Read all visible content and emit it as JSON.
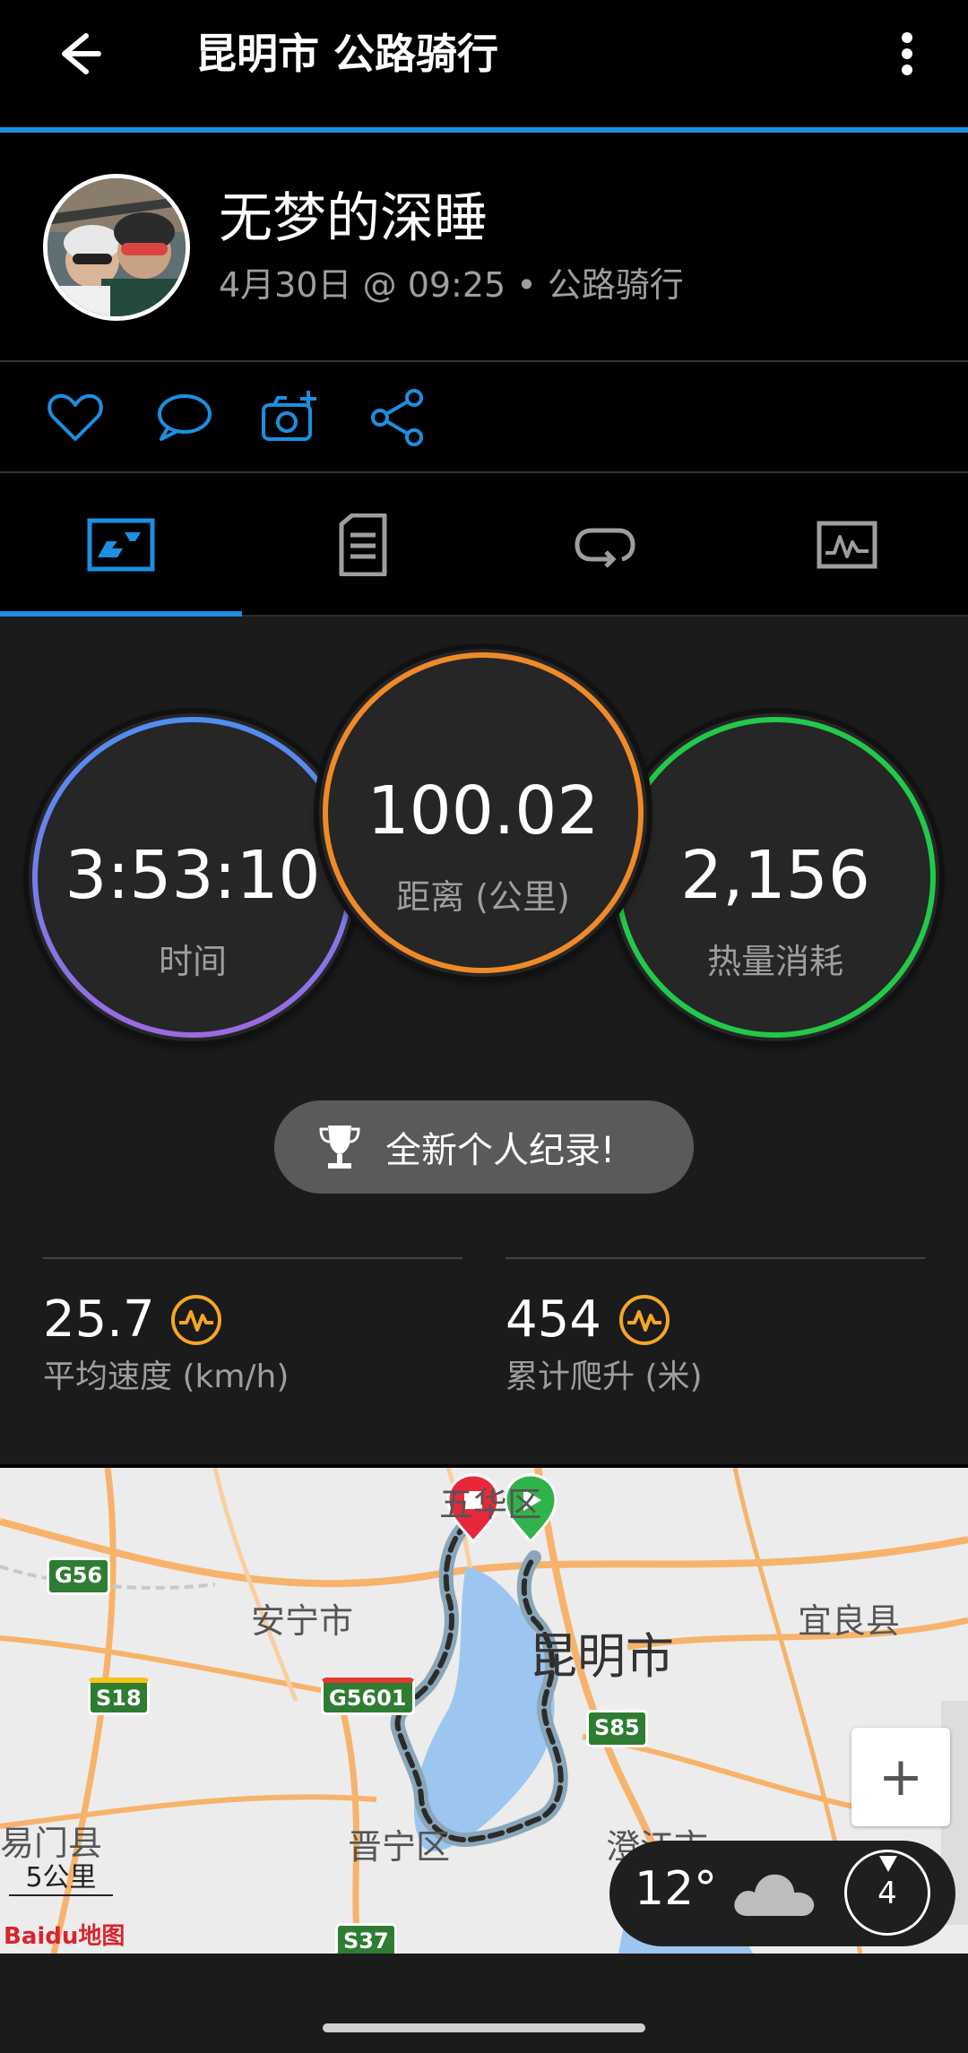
{
  "header": {
    "title": "昆明市 公路骑行",
    "back_icon": "back-arrow-icon",
    "menu_icon": "more-vertical-icon",
    "accent_color": "#1c8fe0"
  },
  "profile": {
    "username": "无梦的深睡",
    "meta": "4月30日 @ 09:25 • 公路骑行"
  },
  "actions": [
    {
      "icon": "heart-icon"
    },
    {
      "icon": "comment-icon"
    },
    {
      "icon": "add-photo-icon"
    },
    {
      "icon": "share-icon"
    }
  ],
  "tabs": [
    {
      "icon": "summary-tab-icon",
      "selected": true
    },
    {
      "icon": "details-tab-icon",
      "selected": false
    },
    {
      "icon": "laps-tab-icon",
      "selected": false
    },
    {
      "icon": "charts-tab-icon",
      "selected": false
    }
  ],
  "summary": {
    "time": {
      "value": "3:53:10",
      "label": "时间",
      "color": "#6a7ef0"
    },
    "distance": {
      "value": "100.02",
      "label": "距离 (公里)",
      "color": "#f08a28"
    },
    "calories": {
      "value": "2,156",
      "label": "热量消耗",
      "color": "#22c94a"
    },
    "record_label": "全新个人纪录!",
    "avg_speed": {
      "value": "25.7",
      "label": "平均速度 (km/h)"
    },
    "ascent": {
      "value": "454",
      "label": "累计爬升 (米)"
    },
    "stat_icon_color": "#f5a623"
  },
  "map": {
    "labels": {
      "wuhua": "五华区",
      "anning": "安宁市",
      "kunming": "昆明市",
      "yiliang": "宜良县",
      "yimen": "易门县",
      "jinning": "晋宁区",
      "chenggong": "澄江市",
      "s85": "S85",
      "g56": "G56",
      "s18": "S18",
      "g5601": "G5601",
      "s37": "S37"
    },
    "scale": "5公里",
    "zoom_in": "+",
    "weather": {
      "temp": "12°",
      "wind": "4",
      "icon": "cloud-icon"
    },
    "provider": "Baidu地图"
  }
}
